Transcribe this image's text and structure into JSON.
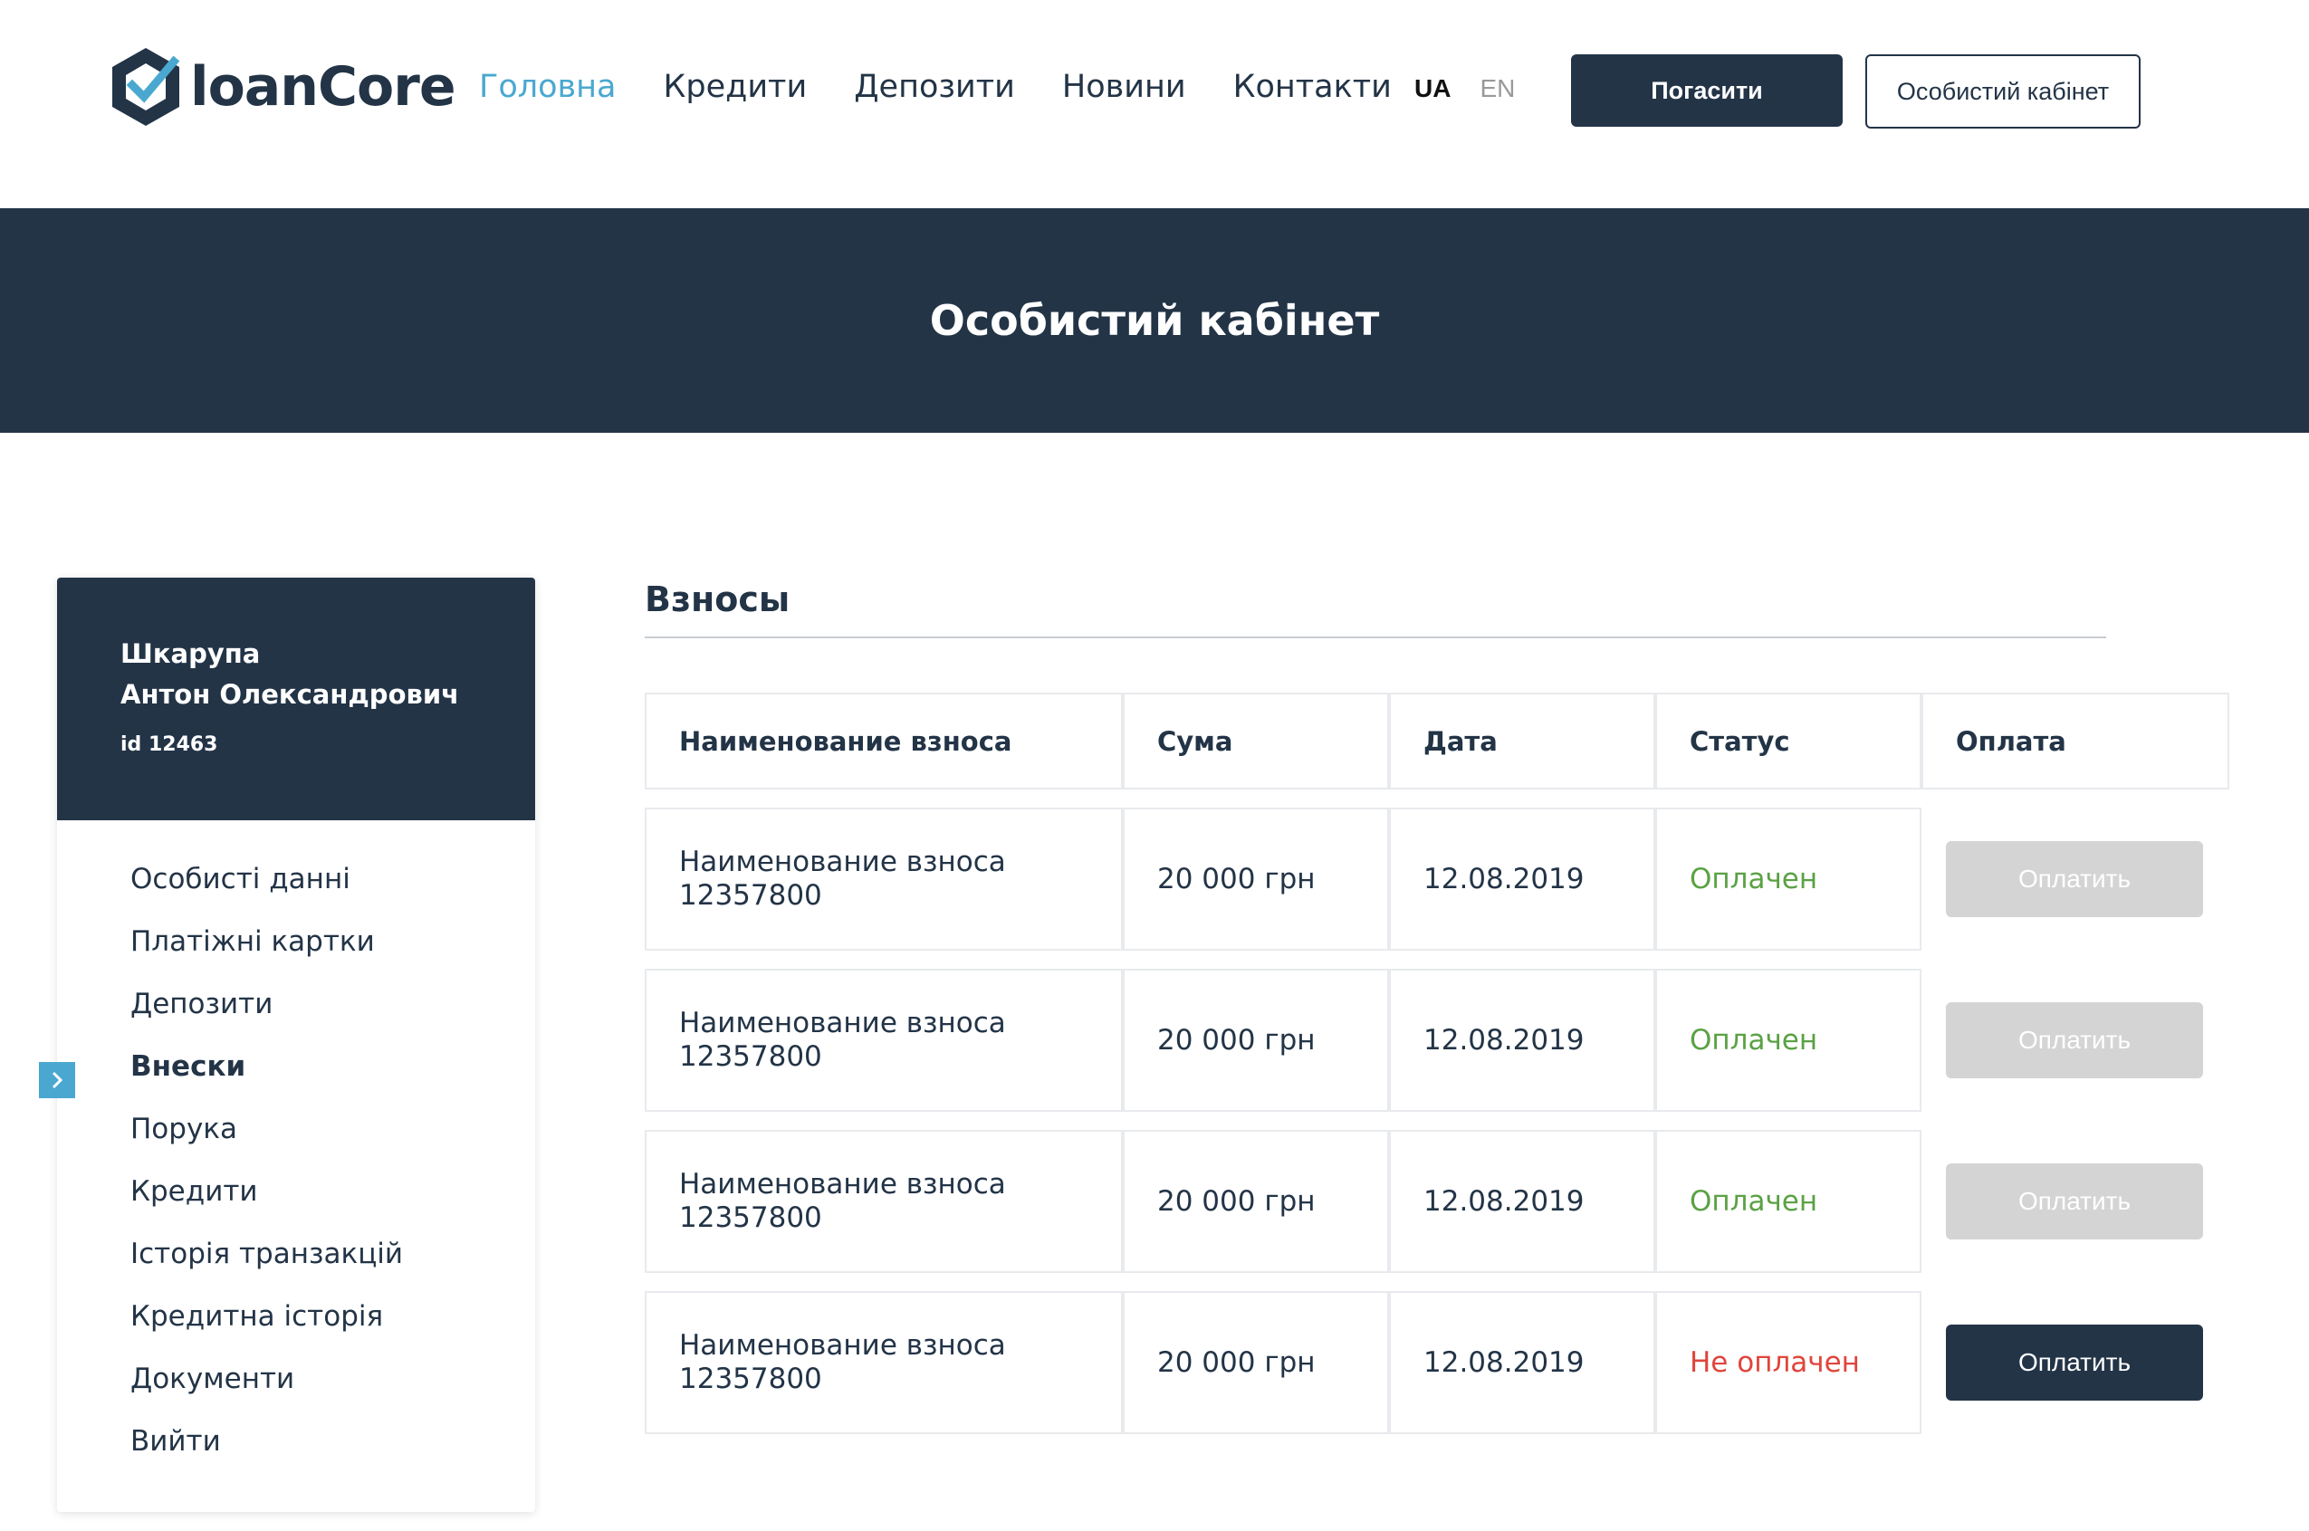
{
  "header": {
    "logo_text": "loanCore",
    "nav": [
      "Головна",
      "Кредити",
      "Депозити",
      "Новини",
      "Контакти"
    ],
    "lang_active": "UA",
    "lang_other": "EN",
    "pay_button": "Погасити",
    "cabinet_button": "Особистий кабінет"
  },
  "hero": {
    "title": "Особистий кабінет"
  },
  "profile": {
    "last_name": "Шкарупа",
    "first_name": "Антон Олександрович",
    "id": "id 12463"
  },
  "menu": [
    "Особисті данні",
    "Платіжні картки",
    "Депозити",
    "Внески",
    "Порука",
    "Кредити",
    "Історія транзакцій",
    "Кредитна історія",
    "Документи",
    "Вийти"
  ],
  "menu_active": "Внески",
  "section": {
    "title": "Взносы"
  },
  "table": {
    "headers": [
      "Наименование взноса",
      "Сума",
      "Дата",
      "Статус",
      "Оплата"
    ],
    "rows": [
      {
        "name": "Наименование взноса",
        "number": "12357800",
        "amount": "20 000 грн",
        "date": "12.08.2019",
        "status": "Оплачен",
        "pay": "Оплатить"
      },
      {
        "name": "Наименование взноса",
        "number": "12357800",
        "amount": "20 000 грн",
        "date": "12.08.2019",
        "status": "Оплачен",
        "pay": "Оплатить"
      },
      {
        "name": "Наименование взноса",
        "number": "12357800",
        "amount": "20 000 грн",
        "date": "12.08.2019",
        "status": "Оплачен",
        "pay": "Оплатить"
      },
      {
        "name": "Наименование взноса",
        "number": "12357800",
        "amount": "20 000 грн",
        "date": "12.08.2019",
        "status": "Не оплачен",
        "pay": "Оплатить"
      }
    ]
  },
  "colors": {
    "navy": "#233447",
    "accent": "#4aa8d0",
    "paid": "#5aa244",
    "unpaid": "#e0453b",
    "disabled": "#d4d4d4"
  }
}
